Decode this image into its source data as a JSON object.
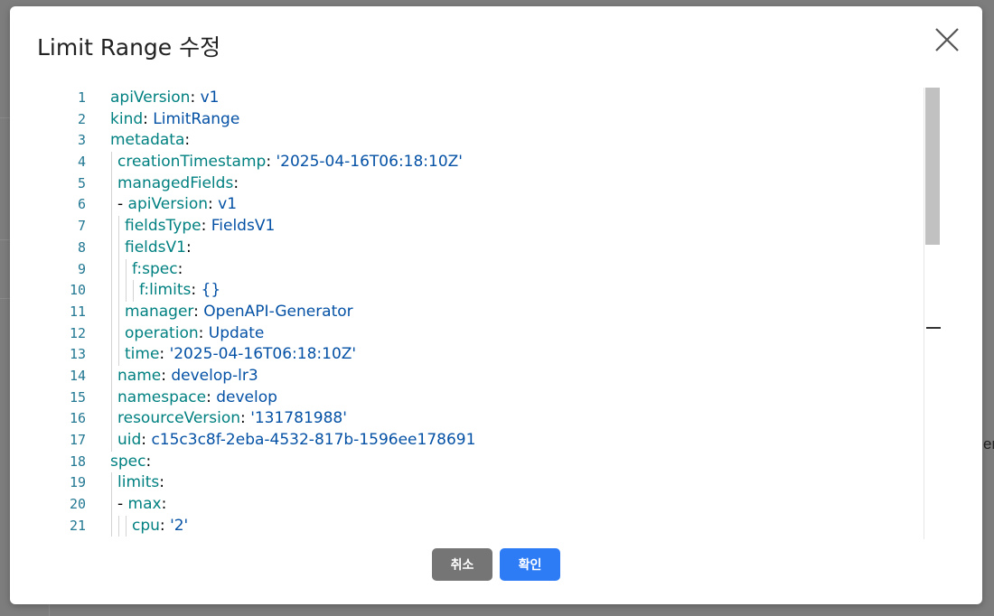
{
  "modal": {
    "title": "Limit Range 수정",
    "close_icon": "close-icon"
  },
  "editor": {
    "lines": [
      {
        "num": "1",
        "indent": 0,
        "parts": [
          {
            "t": "apiVersion",
            "c": "k"
          },
          {
            "t": ": ",
            "c": "p"
          },
          {
            "t": "v1",
            "c": "v"
          }
        ]
      },
      {
        "num": "2",
        "indent": 0,
        "parts": [
          {
            "t": "kind",
            "c": "k"
          },
          {
            "t": ": ",
            "c": "p"
          },
          {
            "t": "LimitRange",
            "c": "v"
          }
        ]
      },
      {
        "num": "3",
        "indent": 0,
        "parts": [
          {
            "t": "metadata",
            "c": "k"
          },
          {
            "t": ":",
            "c": "p"
          }
        ]
      },
      {
        "num": "4",
        "indent": 1,
        "parts": [
          {
            "t": "creationTimestamp",
            "c": "k"
          },
          {
            "t": ": ",
            "c": "p"
          },
          {
            "t": "'2025-04-16T06:18:10Z'",
            "c": "v"
          }
        ]
      },
      {
        "num": "5",
        "indent": 1,
        "parts": [
          {
            "t": "managedFields",
            "c": "k"
          },
          {
            "t": ":",
            "c": "p"
          }
        ]
      },
      {
        "num": "6",
        "indent": 1,
        "parts": [
          {
            "t": "- ",
            "c": "p"
          },
          {
            "t": "apiVersion",
            "c": "k"
          },
          {
            "t": ": ",
            "c": "p"
          },
          {
            "t": "v1",
            "c": "v"
          }
        ]
      },
      {
        "num": "7",
        "indent": 2,
        "parts": [
          {
            "t": "fieldsType",
            "c": "k"
          },
          {
            "t": ": ",
            "c": "p"
          },
          {
            "t": "FieldsV1",
            "c": "v"
          }
        ]
      },
      {
        "num": "8",
        "indent": 2,
        "parts": [
          {
            "t": "fieldsV1",
            "c": "k"
          },
          {
            "t": ":",
            "c": "p"
          }
        ]
      },
      {
        "num": "9",
        "indent": 3,
        "parts": [
          {
            "t": "f:spec",
            "c": "k"
          },
          {
            "t": ":",
            "c": "p"
          }
        ]
      },
      {
        "num": "10",
        "indent": 4,
        "parts": [
          {
            "t": "f:limits",
            "c": "k"
          },
          {
            "t": ": ",
            "c": "p"
          },
          {
            "t": "{}",
            "c": "v"
          }
        ]
      },
      {
        "num": "11",
        "indent": 2,
        "parts": [
          {
            "t": "manager",
            "c": "k"
          },
          {
            "t": ": ",
            "c": "p"
          },
          {
            "t": "OpenAPI-Generator",
            "c": "v"
          }
        ]
      },
      {
        "num": "12",
        "indent": 2,
        "parts": [
          {
            "t": "operation",
            "c": "k"
          },
          {
            "t": ": ",
            "c": "p"
          },
          {
            "t": "Update",
            "c": "v"
          }
        ]
      },
      {
        "num": "13",
        "indent": 2,
        "parts": [
          {
            "t": "time",
            "c": "k"
          },
          {
            "t": ": ",
            "c": "p"
          },
          {
            "t": "'2025-04-16T06:18:10Z'",
            "c": "v"
          }
        ]
      },
      {
        "num": "14",
        "indent": 1,
        "parts": [
          {
            "t": "name",
            "c": "k"
          },
          {
            "t": ": ",
            "c": "p"
          },
          {
            "t": "develop-lr3",
            "c": "v"
          }
        ]
      },
      {
        "num": "15",
        "indent": 1,
        "parts": [
          {
            "t": "namespace",
            "c": "k"
          },
          {
            "t": ": ",
            "c": "p"
          },
          {
            "t": "develop",
            "c": "v"
          }
        ]
      },
      {
        "num": "16",
        "indent": 1,
        "parts": [
          {
            "t": "resourceVersion",
            "c": "k"
          },
          {
            "t": ": ",
            "c": "p"
          },
          {
            "t": "'131781988'",
            "c": "v"
          }
        ]
      },
      {
        "num": "17",
        "indent": 1,
        "parts": [
          {
            "t": "uid",
            "c": "k"
          },
          {
            "t": ": ",
            "c": "p"
          },
          {
            "t": "c15c3c8f-2eba-4532-817b-1596ee178691",
            "c": "v"
          }
        ]
      },
      {
        "num": "18",
        "indent": 0,
        "parts": [
          {
            "t": "spec",
            "c": "k"
          },
          {
            "t": ":",
            "c": "p"
          }
        ]
      },
      {
        "num": "19",
        "indent": 1,
        "parts": [
          {
            "t": "limits",
            "c": "k"
          },
          {
            "t": ":",
            "c": "p"
          }
        ]
      },
      {
        "num": "20",
        "indent": 1,
        "parts": [
          {
            "t": "- ",
            "c": "p"
          },
          {
            "t": "max",
            "c": "k"
          },
          {
            "t": ":",
            "c": "p"
          }
        ]
      },
      {
        "num": "21",
        "indent": 3,
        "parts": [
          {
            "t": "cpu",
            "c": "k"
          },
          {
            "t": ": ",
            "c": "p"
          },
          {
            "t": "'2'",
            "c": "v"
          }
        ]
      }
    ]
  },
  "buttons": {
    "cancel_label": "취소",
    "ok_label": "확인"
  },
  "background": {
    "side_text": "er"
  },
  "colors": {
    "key": "#008080",
    "value": "#0451a5",
    "line_number": "#237893",
    "ok_button": "#2d7cf6",
    "cancel_button": "#757575"
  }
}
